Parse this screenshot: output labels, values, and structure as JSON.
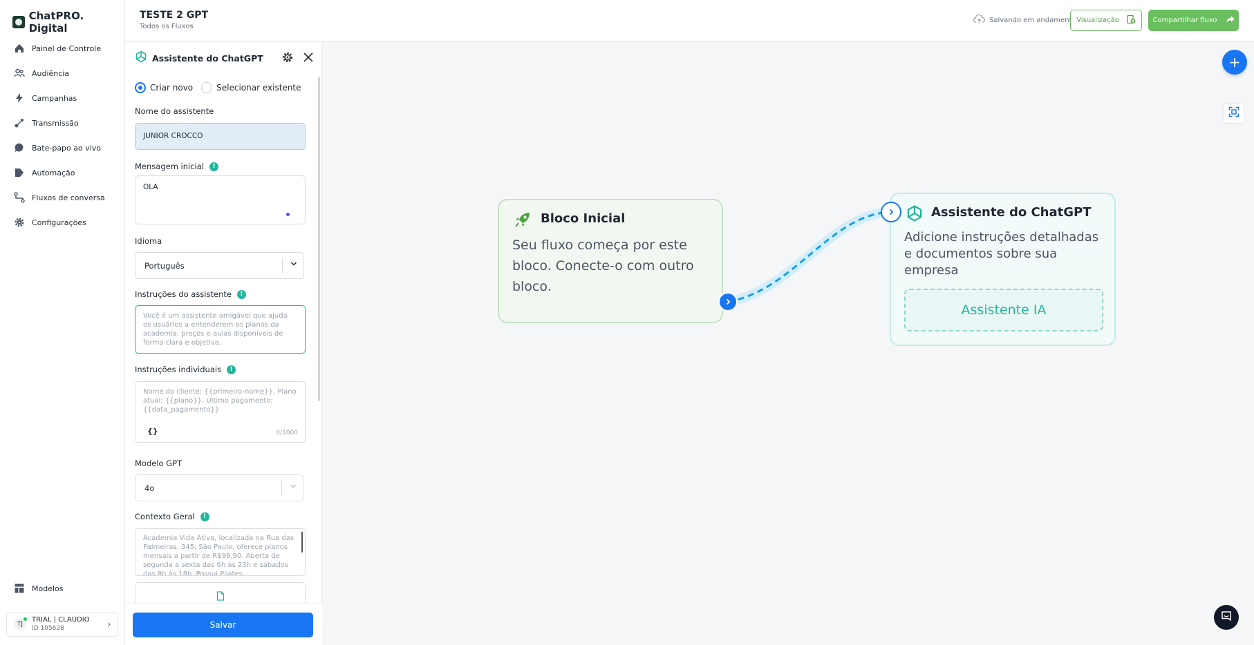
{
  "brand": {
    "name": "ChatPRO. Digital"
  },
  "sidebar": {
    "items": [
      {
        "label": "Painel de Controle",
        "icon": "home-icon"
      },
      {
        "label": "Audiência",
        "icon": "users-icon"
      },
      {
        "label": "Campanhas",
        "icon": "bolt-icon"
      },
      {
        "label": "Transmissão",
        "icon": "broadcast-icon"
      },
      {
        "label": "Bate-papo ao vivo",
        "icon": "chat-icon"
      },
      {
        "label": "Automação",
        "icon": "automation-icon"
      },
      {
        "label": "Fluxos de conversa",
        "icon": "flow-icon"
      },
      {
        "label": "Configurações",
        "icon": "gear-icon"
      }
    ],
    "bottom": {
      "label": "Modelos",
      "icon": "templates-icon"
    },
    "user": {
      "initials": "TJ",
      "name": "TRIAL | CLAUDIO",
      "id": "ID 105628"
    }
  },
  "header": {
    "title": "TESTE 2 GPT",
    "breadcrumb": "Todos os Fluxos",
    "saving_status": "Salvando em andamento",
    "preview_label": "Visualização",
    "share_label": "Compartilhar fluxo"
  },
  "panel": {
    "title": "Assistente do ChatGPT",
    "radio_new": "Criar novo",
    "radio_existing": "Selecionar existente",
    "name_label": "Nome do assistente",
    "name_value": "JUNIOR CROCCO",
    "initial_label": "Mensagem inicial",
    "initial_value": "OLA",
    "language_label": "Idioma",
    "language_value": "Português",
    "instructions_label": "Instruções do assistente",
    "instructions_placeholder": "Você é um assistente amigável que ajuda os usuários a entenderem os planos da academia, preços e aulas disponíveis de forma clara e objetiva.",
    "individual_label": "Instruções individuais",
    "individual_placeholder": "Nome do cliente: {{primeiro-nome}}, Plano atual: {{plano}}, Último pagamento: {{data_pagamento}}",
    "braces": "{}",
    "individual_count": "0/1000",
    "model_label": "Modelo GPT",
    "model_value": "4o",
    "context_label": "Contexto Geral",
    "context_placeholder": "Academia Vida Ativa, localizada na Rua das Palmeiras, 345, São Paulo, oferece planos mensais a partir de R$99,90. Aberta de segunda a sexta das 6h às 23h e sábados das 8h às 18h. Possui Pilates,",
    "save_label": "Salvar"
  },
  "canvas": {
    "start_node": {
      "title": "Bloco Inicial",
      "text": "Seu fluxo começa por este bloco. Conecte-o com outro bloco."
    },
    "gpt_node": {
      "title": "Assistente do ChatGPT",
      "text": "Adicione instruções detalhadas e documentos sobre sua empresa",
      "ai_label": "Assistente IA"
    }
  },
  "colors": {
    "primary": "#1976f2",
    "green": "#6abf5e",
    "teal": "#22b59c"
  }
}
